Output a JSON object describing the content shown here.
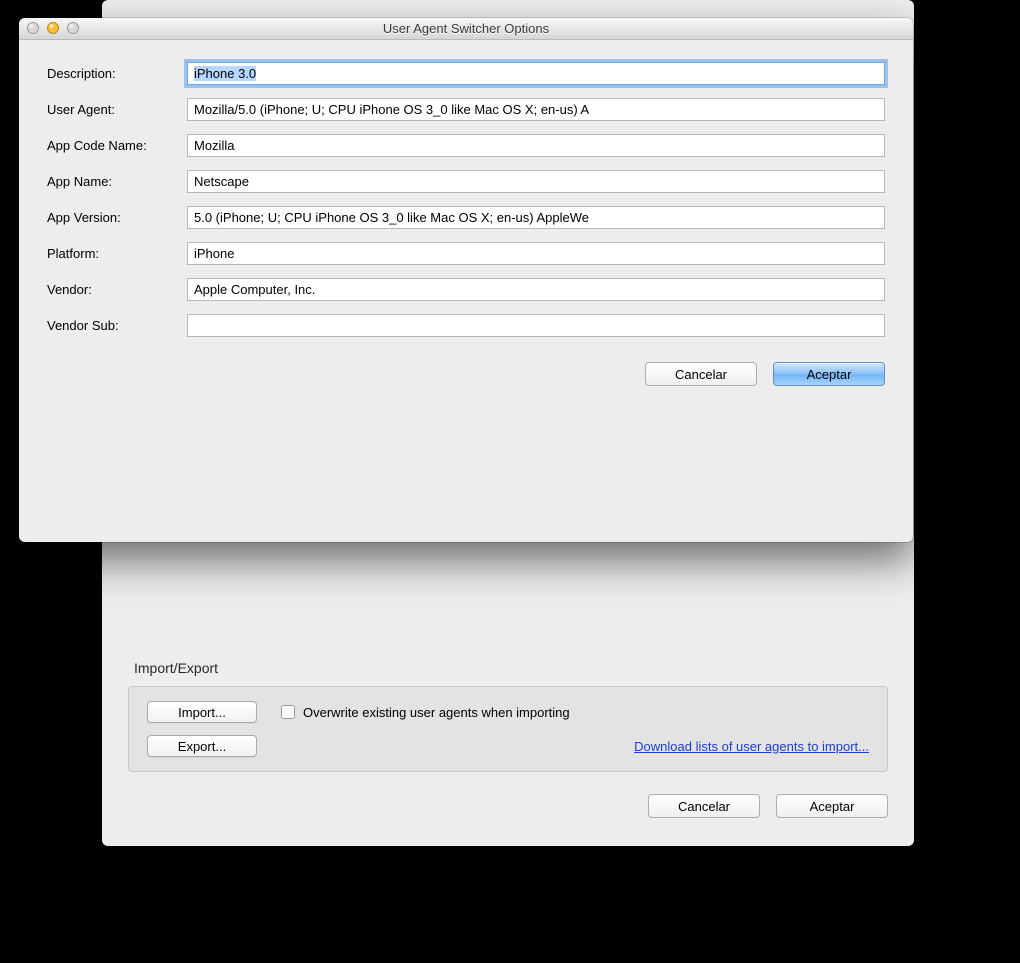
{
  "modal": {
    "title": "User Agent Switcher Options",
    "fields": {
      "description": {
        "label": "Description:",
        "value": "iPhone 3.0"
      },
      "user_agent": {
        "label": "User Agent:",
        "value": "Mozilla/5.0 (iPhone; U; CPU iPhone OS 3_0 like Mac OS X; en-us) A"
      },
      "app_code": {
        "label": "App Code Name:",
        "value": "Mozilla"
      },
      "app_name": {
        "label": "App Name:",
        "value": "Netscape"
      },
      "app_version": {
        "label": "App Version:",
        "value": "5.0 (iPhone; U; CPU iPhone OS 3_0 like Mac OS X; en-us) AppleWe"
      },
      "platform": {
        "label": "Platform:",
        "value": "iPhone"
      },
      "vendor": {
        "label": "Vendor:",
        "value": "Apple Computer, Inc."
      },
      "vendor_sub": {
        "label": "Vendor Sub:",
        "value": ""
      }
    },
    "buttons": {
      "cancel": "Cancelar",
      "accept": "Aceptar"
    }
  },
  "parent": {
    "section_title": "Import/Export",
    "import_label": "Import...",
    "export_label": "Export...",
    "overwrite_label": "Overwrite existing user agents when importing",
    "download_link": "Download lists of user agents to import...",
    "buttons": {
      "cancel": "Cancelar",
      "accept": "Aceptar"
    }
  }
}
